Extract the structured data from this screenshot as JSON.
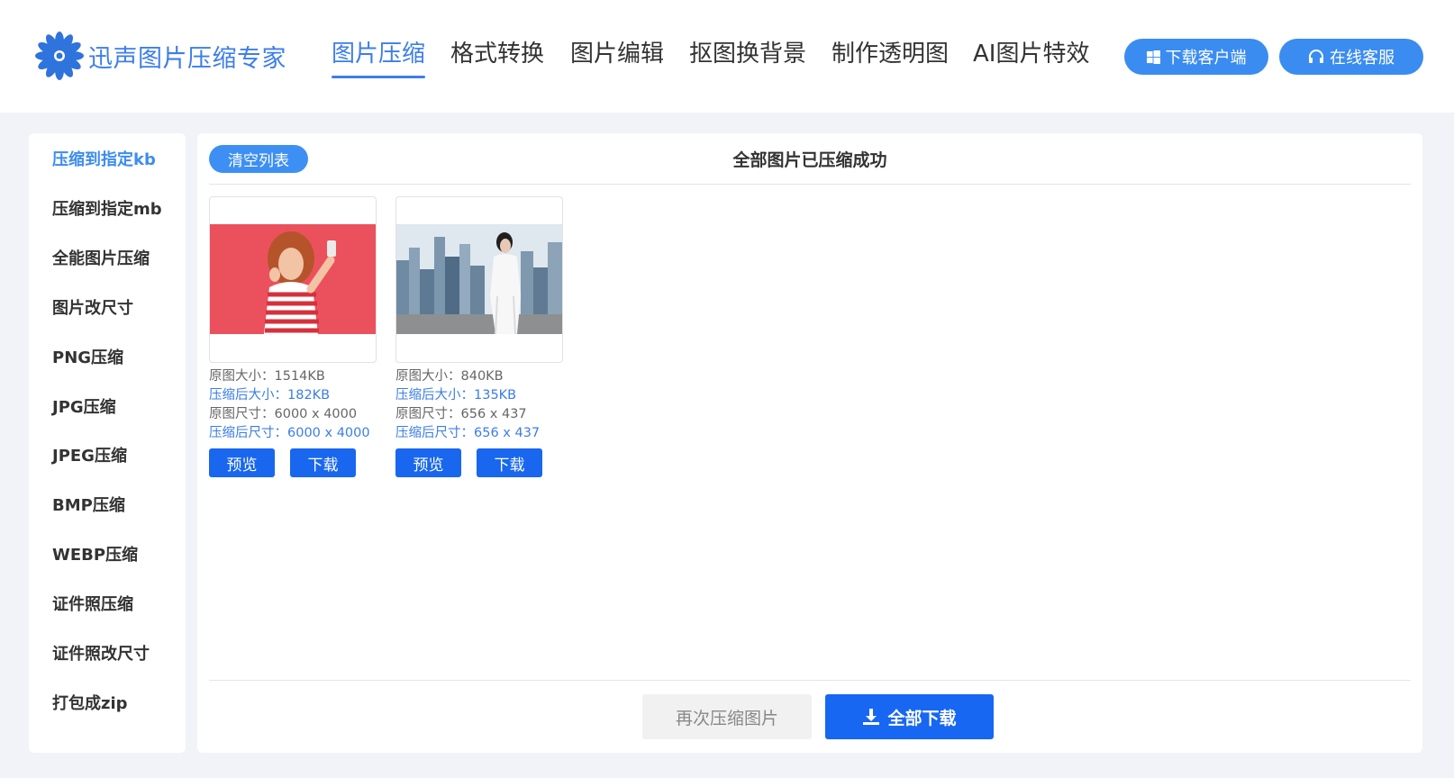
{
  "header": {
    "logo_text": "迅声图片压缩专家",
    "nav": [
      {
        "label": "图片压缩",
        "active": true
      },
      {
        "label": "格式转换"
      },
      {
        "label": "图片编辑"
      },
      {
        "label": "抠图换背景"
      },
      {
        "label": "制作透明图"
      },
      {
        "label": "AI图片特效"
      }
    ],
    "download_client": "下载客户端",
    "online_service": "在线客服"
  },
  "sidebar": {
    "items": [
      {
        "label": "压缩到指定kb",
        "active": true
      },
      {
        "label": "压缩到指定mb"
      },
      {
        "label": "全能图片压缩"
      },
      {
        "label": "图片改尺寸"
      },
      {
        "label": "PNG压缩"
      },
      {
        "label": "JPG压缩"
      },
      {
        "label": "JPEG压缩"
      },
      {
        "label": "BMP压缩"
      },
      {
        "label": "WEBP压缩"
      },
      {
        "label": "证件照压缩"
      },
      {
        "label": "证件照改尺寸"
      },
      {
        "label": "打包成zip"
      }
    ]
  },
  "main": {
    "clear_list": "清空列表",
    "status": "全部图片已压缩成功",
    "images": [
      {
        "original_size": "原图大小：1514KB",
        "compressed_size": "压缩后大小：182KB",
        "original_dims": "原图尺寸：6000 x 4000",
        "compressed_dims": "压缩后尺寸：6000 x 4000",
        "preview": "预览",
        "download": "下载"
      },
      {
        "original_size": "原图大小：840KB",
        "compressed_size": "压缩后大小：135KB",
        "original_dims": "原图尺寸：656 x 437",
        "compressed_dims": "压缩后尺寸：656 x 437",
        "preview": "预览",
        "download": "下载"
      }
    ],
    "recompress": "再次压缩图片",
    "download_all": "全部下载"
  },
  "colors": {
    "accent": "#3d7eea",
    "button_blue": "#1767f2",
    "page_bg": "#f1f3f8"
  }
}
